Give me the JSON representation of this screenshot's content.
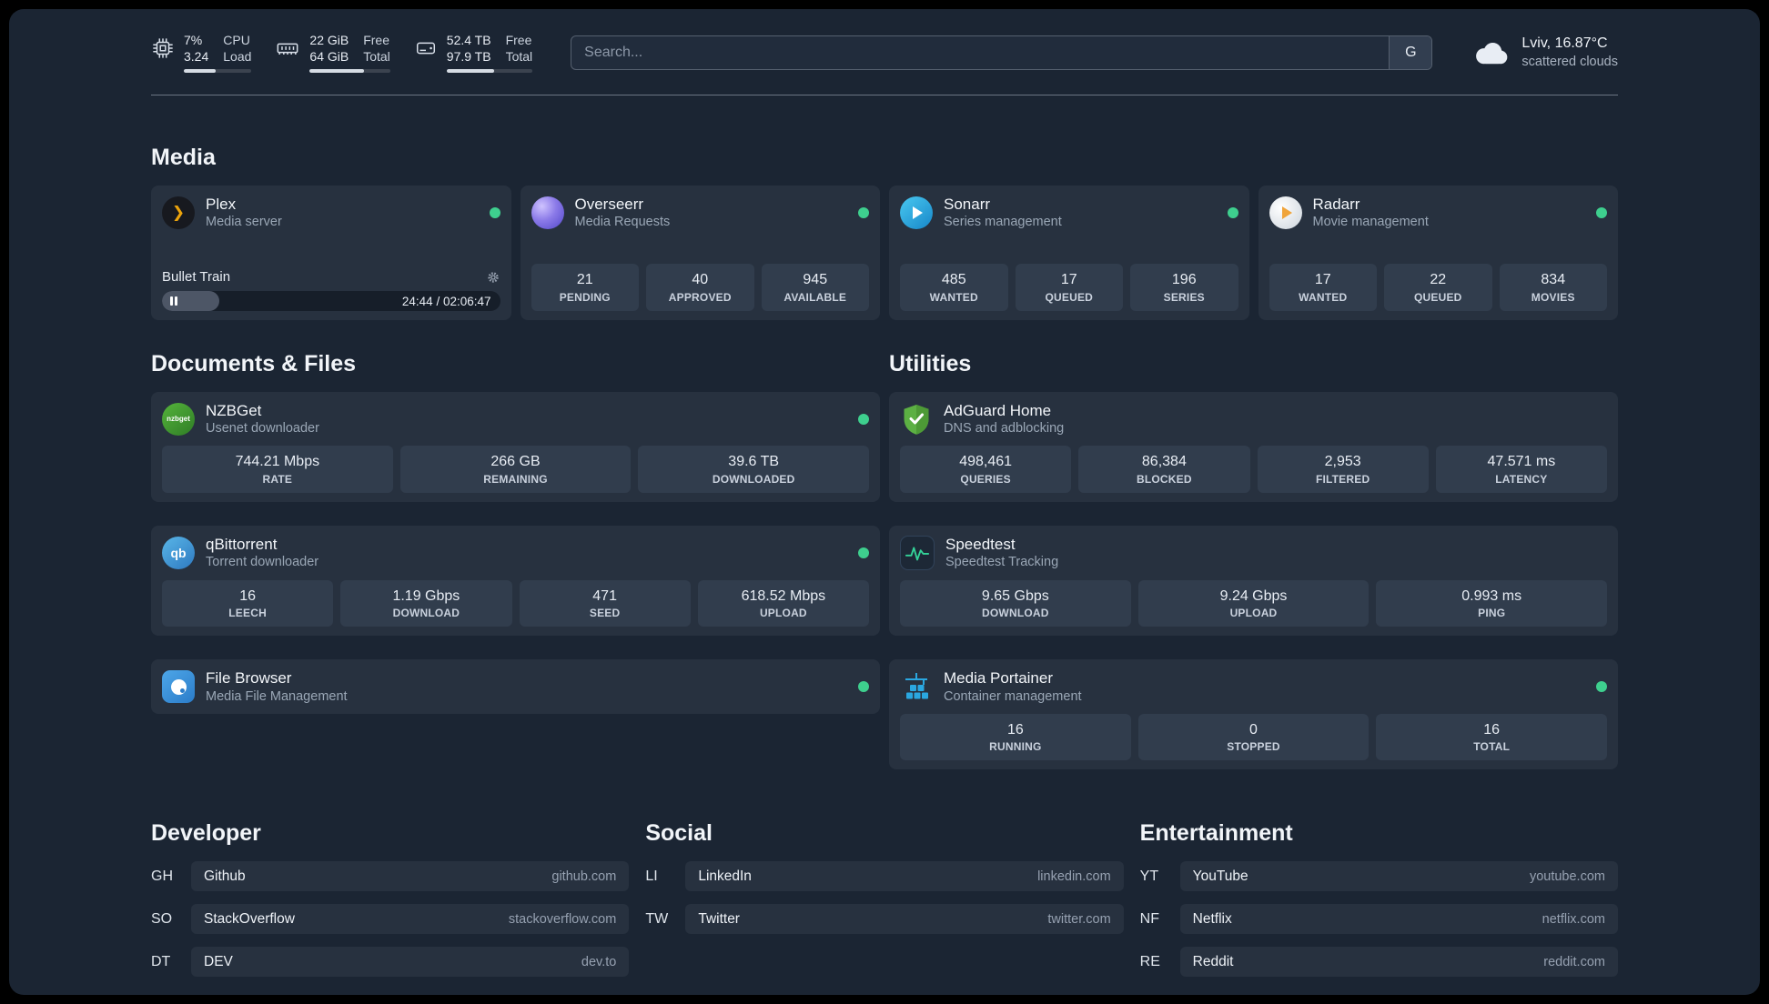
{
  "topbar": {
    "cpu": {
      "value_top": "7%",
      "value_bottom": "3.24",
      "label_top": "CPU",
      "label_bottom": "Load",
      "bar_percent": 47
    },
    "memory": {
      "value_top": "22 GiB",
      "value_bottom": "64 GiB",
      "label_top": "Free",
      "label_bottom": "Total",
      "bar_percent": 67
    },
    "disk": {
      "value_top": "52.4 TB",
      "value_bottom": "97.9 TB",
      "label_top": "Free",
      "label_bottom": "Total",
      "bar_percent": 55
    },
    "search": {
      "placeholder": "Search...",
      "provider_label": "G"
    },
    "weather": {
      "location": "Lviv, 16.87°C",
      "condition": "scattered clouds"
    }
  },
  "sections": {
    "media": {
      "title": "Media",
      "cards": [
        {
          "name": "Plex",
          "subtitle": "Media server",
          "player": {
            "title": "Bullet Train",
            "time": "24:44 / 02:06:47",
            "progress_percent": 17
          }
        },
        {
          "name": "Overseerr",
          "subtitle": "Media Requests",
          "stats": [
            {
              "value": "21",
              "label": "PENDING"
            },
            {
              "value": "40",
              "label": "APPROVED"
            },
            {
              "value": "945",
              "label": "AVAILABLE"
            }
          ]
        },
        {
          "name": "Sonarr",
          "subtitle": "Series management",
          "stats": [
            {
              "value": "485",
              "label": "WANTED"
            },
            {
              "value": "17",
              "label": "QUEUED"
            },
            {
              "value": "196",
              "label": "SERIES"
            }
          ]
        },
        {
          "name": "Radarr",
          "subtitle": "Movie management",
          "stats": [
            {
              "value": "17",
              "label": "WANTED"
            },
            {
              "value": "22",
              "label": "QUEUED"
            },
            {
              "value": "834",
              "label": "MOVIES"
            }
          ]
        }
      ]
    },
    "documents": {
      "title": "Documents & Files",
      "cards": [
        {
          "name": "NZBGet",
          "subtitle": "Usenet downloader",
          "stats": [
            {
              "value": "744.21 Mbps",
              "label": "RATE"
            },
            {
              "value": "266 GB",
              "label": "REMAINING"
            },
            {
              "value": "39.6 TB",
              "label": "DOWNLOADED"
            }
          ]
        },
        {
          "name": "qBittorrent",
          "subtitle": "Torrent downloader",
          "stats": [
            {
              "value": "16",
              "label": "LEECH"
            },
            {
              "value": "1.19 Gbps",
              "label": "DOWNLOAD"
            },
            {
              "value": "471",
              "label": "SEED"
            },
            {
              "value": "618.52 Mbps",
              "label": "UPLOAD"
            }
          ]
        },
        {
          "name": "File Browser",
          "subtitle": "Media File Management"
        }
      ]
    },
    "utilities": {
      "title": "Utilities",
      "cards": [
        {
          "name": "AdGuard Home",
          "subtitle": "DNS and adblocking",
          "stats": [
            {
              "value": "498,461",
              "label": "QUERIES"
            },
            {
              "value": "86,384",
              "label": "BLOCKED"
            },
            {
              "value": "2,953",
              "label": "FILTERED"
            },
            {
              "value": "47.571 ms",
              "label": "LATENCY"
            }
          ]
        },
        {
          "name": "Speedtest",
          "subtitle": "Speedtest Tracking",
          "stats": [
            {
              "value": "9.65 Gbps",
              "label": "DOWNLOAD"
            },
            {
              "value": "9.24 Gbps",
              "label": "UPLOAD"
            },
            {
              "value": "0.993 ms",
              "label": "PING"
            }
          ]
        },
        {
          "name": "Media Portainer",
          "subtitle": "Container management",
          "stats": [
            {
              "value": "16",
              "label": "RUNNING"
            },
            {
              "value": "0",
              "label": "STOPPED"
            },
            {
              "value": "16",
              "label": "TOTAL"
            }
          ]
        }
      ]
    }
  },
  "bookmarks": [
    {
      "title": "Developer",
      "items": [
        {
          "abbr": "GH",
          "name": "Github",
          "domain": "github.com"
        },
        {
          "abbr": "SO",
          "name": "StackOverflow",
          "domain": "stackoverflow.com"
        },
        {
          "abbr": "DT",
          "name": "DEV",
          "domain": "dev.to"
        }
      ]
    },
    {
      "title": "Social",
      "items": [
        {
          "abbr": "LI",
          "name": "LinkedIn",
          "domain": "linkedin.com"
        },
        {
          "abbr": "TW",
          "name": "Twitter",
          "domain": "twitter.com"
        }
      ]
    },
    {
      "title": "Entertainment",
      "items": [
        {
          "abbr": "YT",
          "name": "YouTube",
          "domain": "youtube.com"
        },
        {
          "abbr": "NF",
          "name": "Netflix",
          "domain": "netflix.com"
        },
        {
          "abbr": "RE",
          "name": "Reddit",
          "domain": "reddit.com"
        }
      ]
    }
  ],
  "icons": {
    "plex_glyph": "❯",
    "nzbget_text": "nzbget",
    "qbittorrent_text": "qb"
  }
}
